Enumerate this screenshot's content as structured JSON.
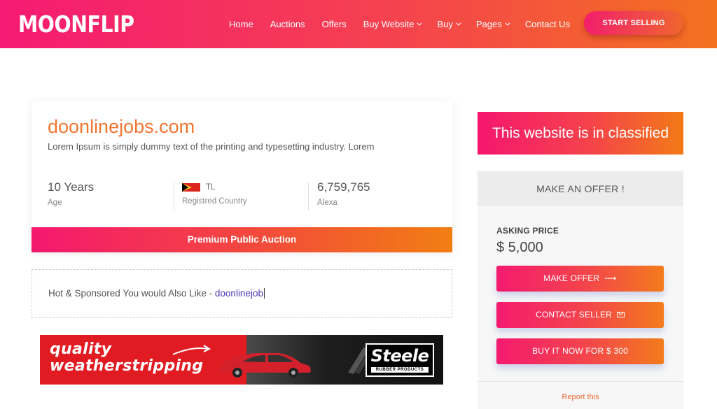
{
  "header": {
    "logo": "MOONFLIP",
    "nav": [
      {
        "label": "Home",
        "dropdown": false
      },
      {
        "label": "Auctions",
        "dropdown": false
      },
      {
        "label": "Offers",
        "dropdown": false
      },
      {
        "label": "Buy Website",
        "dropdown": true
      },
      {
        "label": "Buy",
        "dropdown": true
      },
      {
        "label": "Pages",
        "dropdown": true
      },
      {
        "label": "Contact Us",
        "dropdown": false
      }
    ],
    "cta": "START SELLING"
  },
  "listing": {
    "domain": "doonlinejobs.com",
    "description": "Lorem Ipsum is simply dummy text of the printing and typesetting industry. Lorem",
    "stats": {
      "age_value": "10 Years",
      "age_label": "Age",
      "country_code": "TL",
      "country_label": "Registred Country",
      "alexa_value": "6,759,765",
      "alexa_label": "Alexa"
    },
    "auction_label": "Premium Public Auction"
  },
  "sponsored": {
    "text": "Hot & Sponsored You would Also Like - ",
    "link": "doonlinejob"
  },
  "ad": {
    "line1": "quality",
    "line2": "weatherstripping",
    "brand": "Steele",
    "brand_sub": "RUBBER PRODUCTS"
  },
  "sidebar": {
    "classified": "This website is in classified",
    "offer_title": "MAKE AN OFFER !",
    "asking_label": "ASKING PRICE",
    "asking_value": "$ 5,000",
    "buttons": {
      "make_offer": "MAKE OFFER",
      "contact_seller": "CONTACT SELLER",
      "buy_now": "BUY IT NOW FOR $ 300"
    },
    "report": "Report this"
  },
  "colors": {
    "brand_pink": "#f51a73",
    "brand_orange": "#f3711f",
    "domain_text": "#f07532",
    "link": "#4a3ab8"
  }
}
